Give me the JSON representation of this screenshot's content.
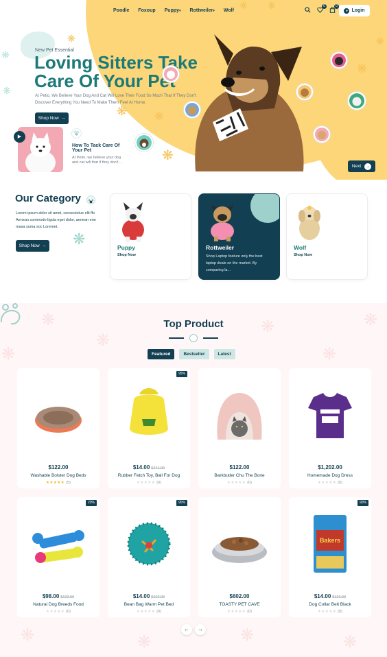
{
  "nav": {
    "items": [
      {
        "label": "Poodle"
      },
      {
        "label": "Foxoup"
      },
      {
        "label": "Puppy",
        "caret": "▾"
      },
      {
        "label": "Rottweiler",
        "caret": "▾"
      },
      {
        "label": "Wolf"
      }
    ],
    "wishlist_count": "0",
    "cart_count": "0",
    "login_label": "Login"
  },
  "hero": {
    "eyebrow": "New Pet Essential",
    "title": "Loving Sitters Take Care Of Your Pet",
    "description": "At Petio, We Believe Your Dog And Cat Will Love Their Food So Much That If They Don't Discover Everything You Need To Make Them Feel At Home.",
    "shop_label": "Shop Now",
    "tip_title": "How To Tack Care Of Your Pet",
    "tip_text": "At Petio, we believe your dog and cat will that if they don't ...",
    "next_label": "Next"
  },
  "category": {
    "title": "Our Category",
    "description": "Lorem ipsum dolor sit amet, consectetue elit ffo Aenean commodo ligula eget dolor, aenean ene masa suma soc Loremet.",
    "shop_label": "Shop Now",
    "cards": [
      {
        "name": "Puppy",
        "link": "Shop Now"
      },
      {
        "name": "Rottweiler",
        "desc": "Shop Laptop feature only the best laptop deals on the market. By comparing la..."
      },
      {
        "name": "Wolf",
        "link": "Shop Now"
      }
    ]
  },
  "products": {
    "title": "Top Product",
    "tabs": [
      "Featured",
      "Bestseller",
      "Latest"
    ],
    "items": [
      {
        "name": "Washable Bolster Dog Beds",
        "price": "$122.00",
        "old_price": "",
        "discount": "",
        "rating": "(5)",
        "rated": true
      },
      {
        "name": "Rubber Fetch Toy, Ball For Dog",
        "price": "$14.00",
        "old_price": "$241.99",
        "discount": "95%",
        "rating": "(0)",
        "rated": false
      },
      {
        "name": "Barkbutler Chu The Bone",
        "price": "$122.00",
        "old_price": "",
        "discount": "",
        "rating": "(0)",
        "rated": false
      },
      {
        "name": "Homemade Dog Dress",
        "price": "$1,202.00",
        "old_price": "",
        "discount": "",
        "rating": "(0)",
        "rated": false
      },
      {
        "name": "Natural Dog Breeds Food",
        "price": "$98.00",
        "old_price": "$122.00",
        "discount": "20%",
        "rating": "(0)",
        "rated": false
      },
      {
        "name": "Bean Bag Warm Pet Bed",
        "price": "$14.00",
        "old_price": "$122.00",
        "discount": "90%",
        "rating": "(0)",
        "rated": false
      },
      {
        "name": "TOASTY PET CAVE",
        "price": "$602.00",
        "old_price": "",
        "discount": "",
        "rating": "(0)",
        "rated": false
      },
      {
        "name": "Dog Collar Belt Black",
        "price": "$14.00",
        "old_price": "$122.00",
        "discount": "90%",
        "rating": "(0)",
        "rated": false
      }
    ],
    "bed_brand": "Bakers"
  },
  "colors": {
    "primary": "#123f52",
    "accent": "#1b7a78",
    "hero_yellow": "#fcd679",
    "mint": "#9ed0cc"
  },
  "icons": {
    "search": "search-icon",
    "wishlist": "heart-icon",
    "cart": "bag-icon",
    "user": "user-icon",
    "play": "play-icon",
    "arrow": "arrow-right-icon"
  }
}
